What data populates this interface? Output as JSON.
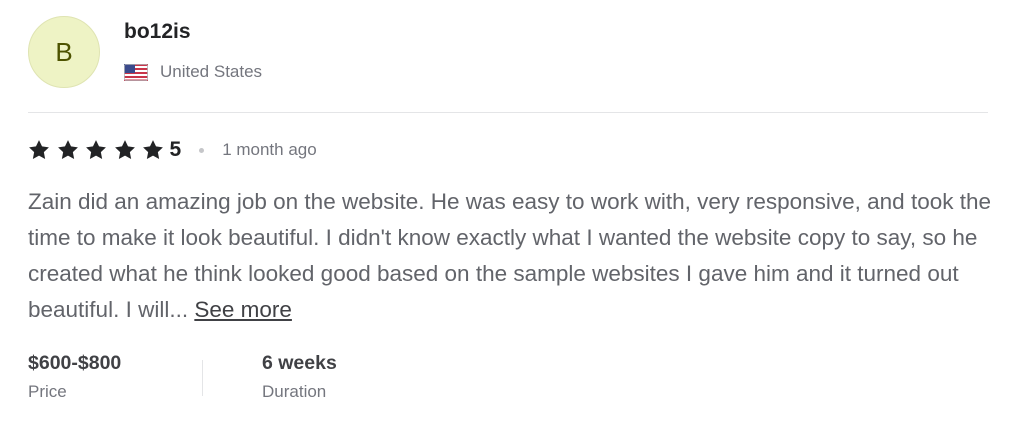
{
  "reviewer": {
    "avatar_initial": "B",
    "username": "bo12is",
    "country": "United States",
    "flag_icon": "us-flag-icon"
  },
  "rating": {
    "stars": 5,
    "value": "5",
    "time_ago": "1 month ago",
    "star_color": "#222325"
  },
  "review": {
    "text": "Zain did an amazing job on the website. He was easy to work with, very responsive, and took the time to make it look beautiful. I didn't know exactly what I wanted the website copy to say, so he created what he think looked good based on the sample websites I gave him and it turned out beautiful. I will...",
    "see_more_label": "See more"
  },
  "details": {
    "price_value": "$600-$800",
    "price_label": "Price",
    "duration_value": "6 weeks",
    "duration_label": "Duration"
  },
  "colors": {
    "avatar_bg": "#eef3c5",
    "avatar_text": "#4d5300"
  }
}
